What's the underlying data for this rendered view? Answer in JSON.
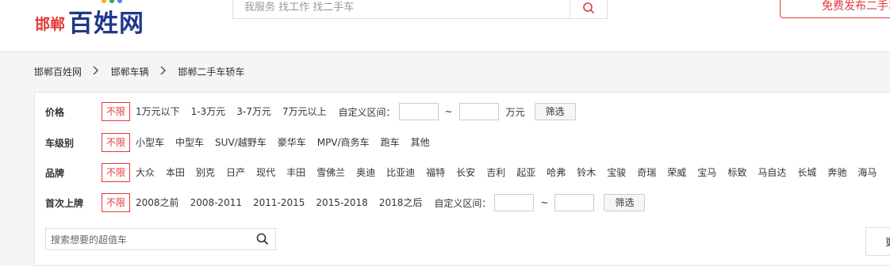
{
  "header": {
    "logo_city": "邯郸",
    "logo_brand": "百姓网",
    "logo_dot_colors": [
      "#f4b400",
      "#34a853",
      "#4285f4"
    ],
    "search_placeholder": "我服务 找工作 找二手车",
    "search_icon": "search-icon",
    "publish_label": "免费发布二手车",
    "accent_color": "#e5383b",
    "brand_color": "#1f3a8a"
  },
  "breadcrumb": [
    "邯郸百姓网",
    "邯郸车辆",
    "邯郸二手车轿车"
  ],
  "filters": {
    "price": {
      "label": "价格",
      "unlimited": "不限",
      "options": [
        "1万元以下",
        "1-3万元",
        "3-7万元",
        "7万元以上"
      ],
      "custom_label": "自定义区间：",
      "tilde": "~",
      "unit": "万元",
      "button": "筛选"
    },
    "level": {
      "label": "车级别",
      "unlimited": "不限",
      "options": [
        "小型车",
        "中型车",
        "SUV/越野车",
        "豪华车",
        "MPV/商务车",
        "跑车",
        "其他"
      ]
    },
    "brand": {
      "label": "品牌",
      "unlimited": "不限",
      "options": [
        "大众",
        "本田",
        "别克",
        "日产",
        "现代",
        "丰田",
        "雪佛兰",
        "奥迪",
        "比亚迪",
        "福特",
        "长安",
        "吉利",
        "起亚",
        "哈弗",
        "铃木",
        "宝骏",
        "奇瑞",
        "荣威",
        "宝马",
        "标致",
        "马自达",
        "长城",
        "奔驰",
        "海马"
      ]
    },
    "first_reg": {
      "label": "首次上牌",
      "unlimited": "不限",
      "options": [
        "2008之前",
        "2008-2011",
        "2011-2015",
        "2015-2018",
        "2018之后"
      ],
      "custom_label": "自定义区间：",
      "tilde": "~",
      "button": "筛选"
    },
    "keyword_placeholder": "搜索想要的超值车",
    "more_label": "更"
  }
}
